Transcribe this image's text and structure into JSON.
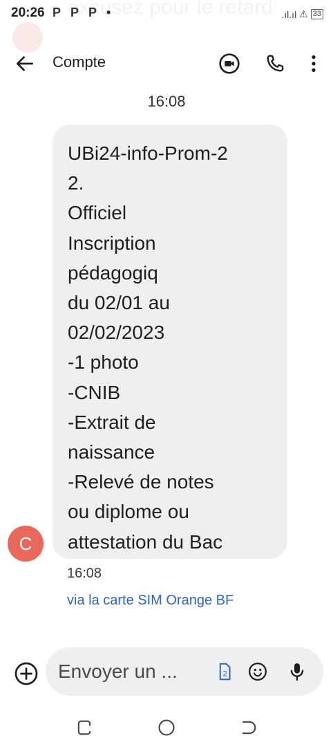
{
  "status_bar": {
    "time": "20:26",
    "app_icons": [
      "P",
      "P",
      "P",
      "•"
    ],
    "signal": ".ıl.ıl",
    "alert": "⚠",
    "battery": "33"
  },
  "ghost_notification": {
    "text": "excusez pour le retard"
  },
  "app_bar": {
    "title": "Compte"
  },
  "conversation": {
    "date_separator": "16:08",
    "sender_initial": "C",
    "message": {
      "lines": [
        "UBi24-info-Prom-2",
        "2.",
        "Officiel",
        "Inscription",
        "pédagogiq",
        "du 02/01 au",
        "02/02/2023",
        "-1 photo",
        "-CNIB",
        "-Extrait de",
        "naissance",
        "-Relevé de notes",
        "ou diplome ou",
        "attestation du Bac"
      ],
      "time": "16:08",
      "via": "via la carte SIM Orange BF"
    }
  },
  "compose": {
    "placeholder": "Envoyer un ...",
    "sim_number": "2"
  },
  "colors": {
    "avatar": "#e8685b",
    "bubble": "#eeeff1",
    "link": "#2b63c6"
  }
}
